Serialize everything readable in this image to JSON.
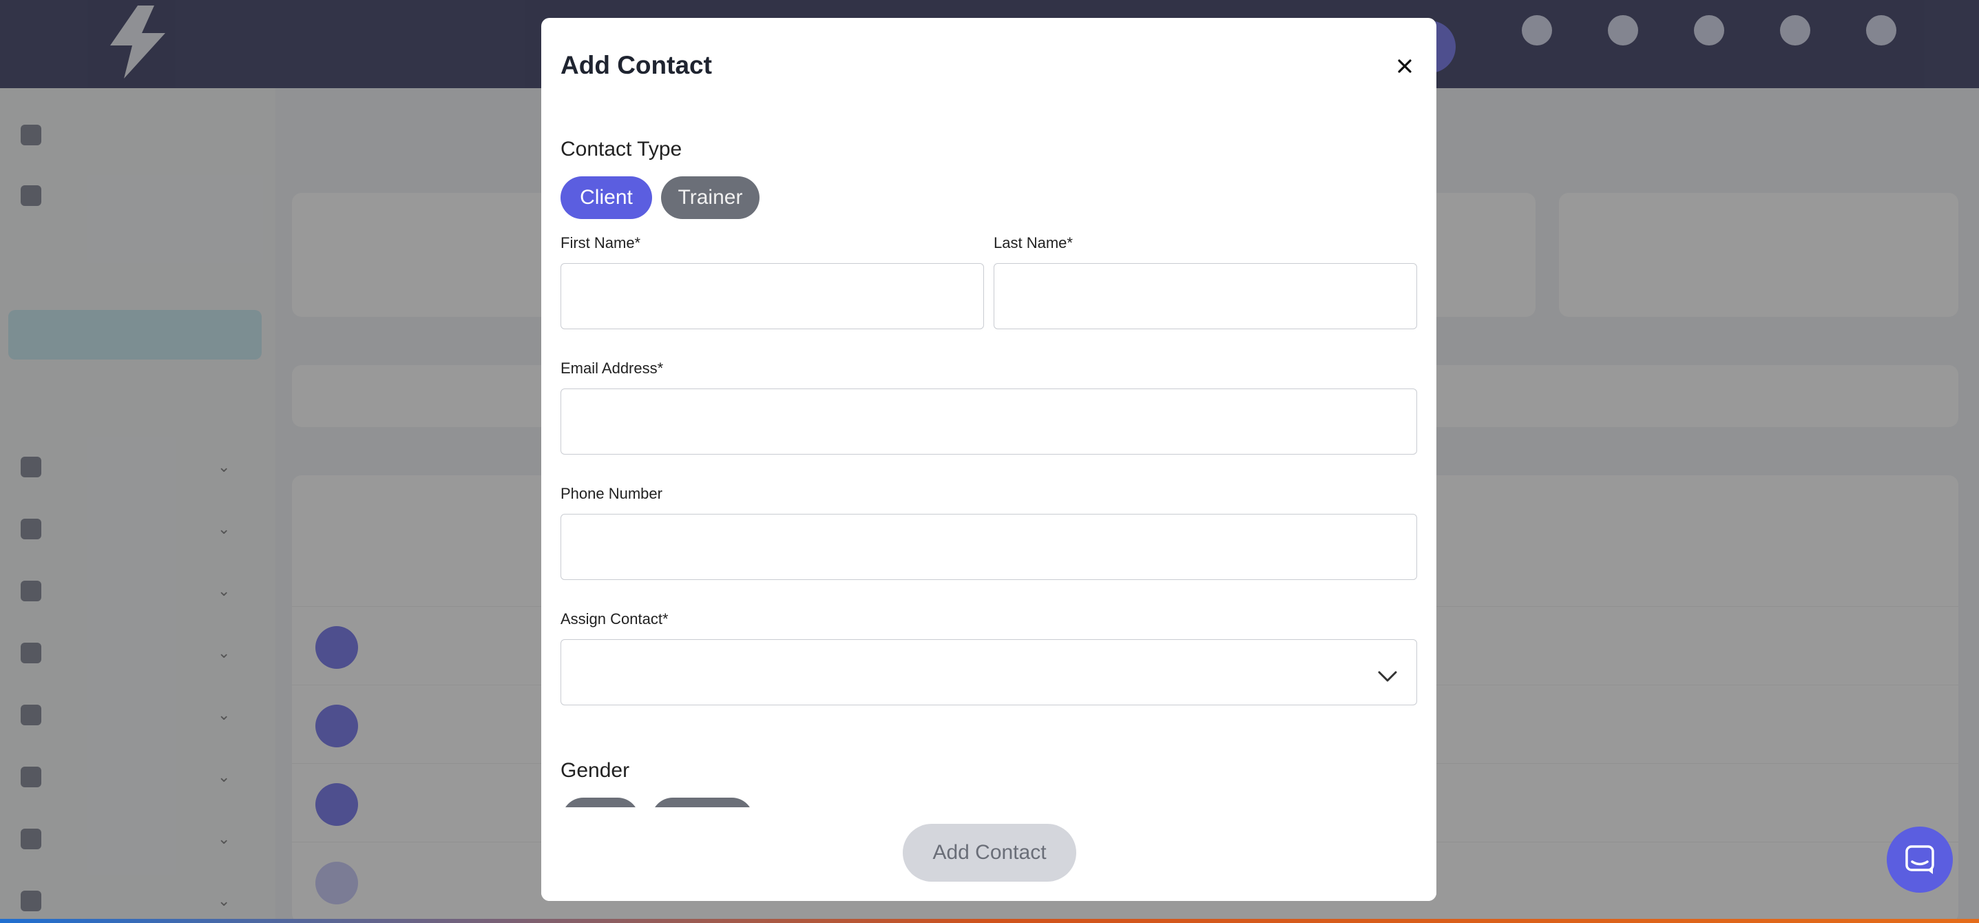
{
  "modal": {
    "title": "Add Contact",
    "contact_type_label": "Contact Type",
    "contact_types": [
      "Client",
      "Trainer"
    ],
    "selected_contact_type": "Client",
    "first_name_label": "First Name*",
    "last_name_label": "Last Name*",
    "email_label": "Email Address*",
    "phone_label": "Phone Number",
    "assign_label": "Assign Contact*",
    "gender_label": "Gender",
    "first_name_value": "",
    "last_name_value": "",
    "email_value": "",
    "phone_value": "",
    "assign_value": "",
    "submit_label": "Add Contact"
  },
  "colors": {
    "accent": "#5b5ee0",
    "topbar": "#1b1d4a",
    "pill_inactive": "#6b6f78",
    "submit_disabled": "#d4d6dc",
    "overlay": "rgba(70,70,70,0.55)"
  },
  "icons": {
    "close": "close-icon",
    "select": "chevron-down-icon",
    "chat": "chat-bubble-icon"
  }
}
